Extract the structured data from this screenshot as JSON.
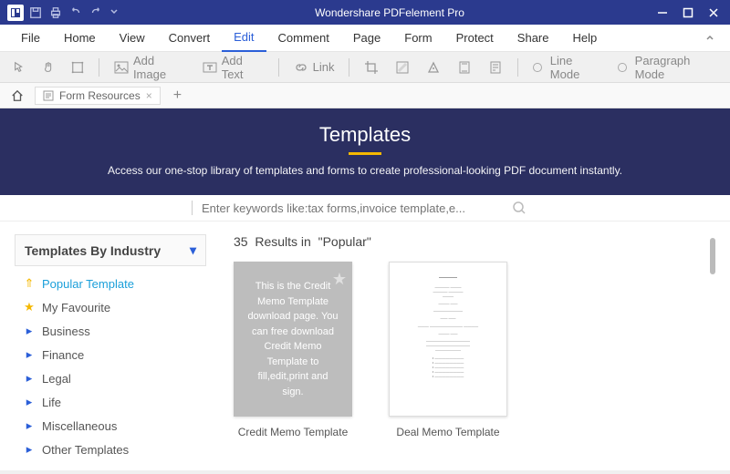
{
  "titlebar": {
    "app_title": "Wondershare PDFelement Pro"
  },
  "menu": {
    "items": [
      "File",
      "Home",
      "View",
      "Convert",
      "Edit",
      "Comment",
      "Page",
      "Form",
      "Protect",
      "Share",
      "Help"
    ],
    "active_index": 4
  },
  "toolbar": {
    "add_image": "Add Image",
    "add_text": "Add Text",
    "link": "Link",
    "line_mode": "Line Mode",
    "paragraph_mode": "Paragraph Mode"
  },
  "tabs": {
    "tab1_label": "Form Resources",
    "close": "×",
    "plus": "+"
  },
  "banner": {
    "title": "Templates",
    "subtitle": "Access our one-stop library of templates and forms to create professional-looking PDF document instantly."
  },
  "search": {
    "placeholder": "Enter keywords like:tax forms,invoice template,e..."
  },
  "sidebar": {
    "header": "Templates By Industry",
    "items": [
      {
        "label": "Popular Template",
        "icon": "popular",
        "active": true
      },
      {
        "label": "My Favourite",
        "icon": "star"
      },
      {
        "label": "Business",
        "icon": "arrow"
      },
      {
        "label": "Finance",
        "icon": "arrow"
      },
      {
        "label": "Legal",
        "icon": "arrow"
      },
      {
        "label": "Life",
        "icon": "arrow"
      },
      {
        "label": "Miscellaneous",
        "icon": "arrow"
      },
      {
        "label": "Other Templates",
        "icon": "arrow"
      }
    ]
  },
  "results": {
    "count": "35",
    "heading_prefix": "Results in",
    "heading_filter": "\"Popular\"",
    "cards": [
      {
        "label": "Credit Memo Template",
        "preview_text": "This is the Credit Memo Template download page. You can free download Credit Memo Template to fill,edit,print and sign."
      },
      {
        "label": "Deal Memo Template",
        "preview_text": ""
      }
    ]
  }
}
